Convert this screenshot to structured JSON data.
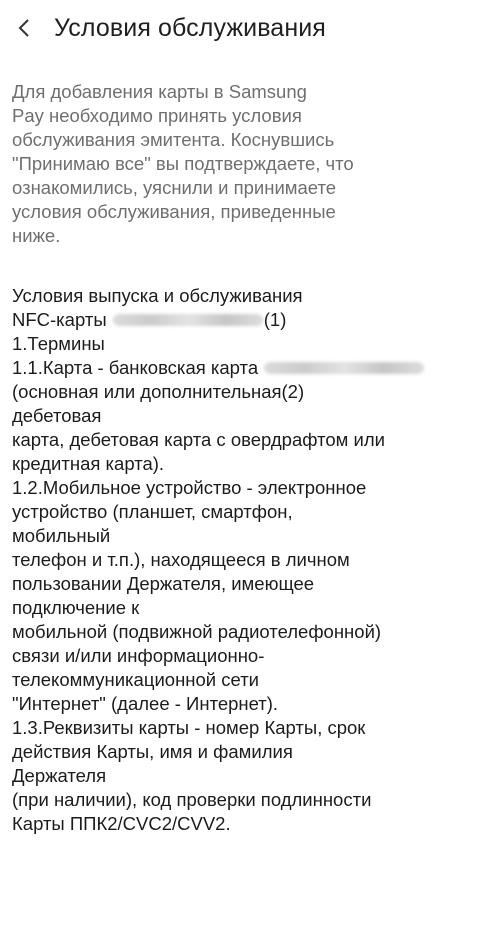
{
  "header": {
    "back_label": "<",
    "title": "Условия обслуживания"
  },
  "intro": {
    "lines": [
      "Для добавления карты в Samsung",
      "Pay необходимо принять условия",
      "обслуживания эмитента. Коснувшись",
      "\"Принимаю все\" вы подтверждаете, что",
      "ознакомились, уяснили и принимаете",
      "условия обслуживания, приведенные",
      "ниже."
    ]
  },
  "terms": {
    "heading_line1": "Условия выпуска и обслуживания",
    "heading_line2_prefix": "NFC-карты",
    "heading_line2_suffix": "(1)",
    "section_title": "1.Термины",
    "def_1_1_prefix": "1.1.Карта - банковская карта",
    "lines_after_1_1": [
      "(основная или дополнительная(2)",
      "дебетовая",
      "карта, дебетовая карта с овердрафтом или",
      "кредитная карта).",
      "1.2.Мобильное устройство - электронное",
      "устройство (планшет, смартфон,",
      "мобильный",
      "телефон и т.п.), находящееся в личном",
      "пользовании Держателя, имеющее",
      "подключение к",
      "мобильной (подвижной радиотелефонной)",
      "связи и/или информационно-",
      "телекоммуникационной сети",
      "\"Интернет\" (далее - Интернет).",
      "1.3.Реквизиты карты - номер Карты, срок",
      "действия Карты, имя и фамилия",
      "Держателя",
      "(при наличии), код проверки подлинности",
      "Карты ППК2/CVC2/CVV2."
    ]
  }
}
